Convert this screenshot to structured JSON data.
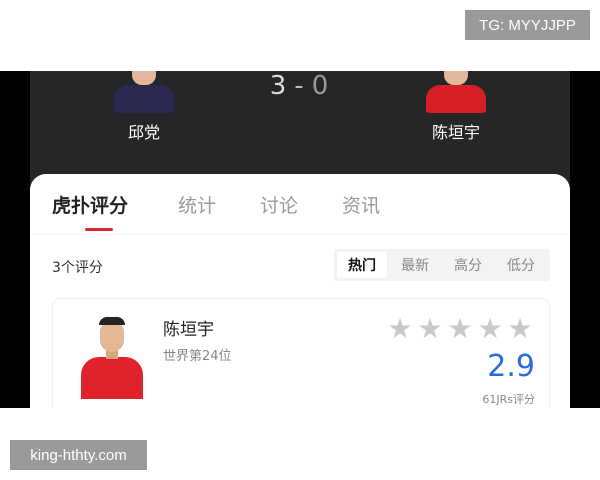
{
  "watermarks": {
    "top": "TG: MYYJJPP",
    "bottom": "king-hthty.com"
  },
  "match": {
    "player_left": "邱党",
    "player_right": "陈垣宇",
    "score_left": "3",
    "score_separator": "-",
    "score_right": "0"
  },
  "tabs": [
    {
      "label": "虎扑评分",
      "active": true
    },
    {
      "label": "统计",
      "active": false
    },
    {
      "label": "讨论",
      "active": false
    },
    {
      "label": "资讯",
      "active": false
    }
  ],
  "ratings": {
    "count_label": "3个评分",
    "sort_options": [
      "热门",
      "最新",
      "高分",
      "低分"
    ],
    "active_sort": "热门"
  },
  "rating_card": {
    "name": "陈垣宇",
    "rank": "世界第24位",
    "stars_total": 5,
    "stars_filled": 0,
    "score": "2.9",
    "votes": "61JRs评分"
  },
  "colors": {
    "accent_red": "#d62a32",
    "score_blue": "#2b6cdc",
    "dark_header": "#262528"
  }
}
